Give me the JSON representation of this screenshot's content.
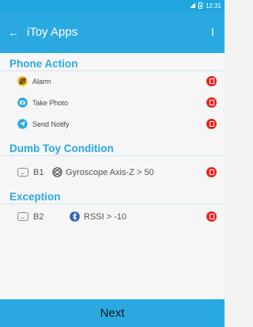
{
  "status_bar": {
    "time": "12:31"
  },
  "app_bar": {
    "back_glyph": "←",
    "title": "iToy Apps"
  },
  "sections": {
    "phone_action": {
      "title": "Phone Action",
      "items": [
        {
          "label": "Alarm",
          "icon": "alarm-icon",
          "color": "#f4b400"
        },
        {
          "label": "Take Photo",
          "icon": "camera-icon",
          "color": "#2aa9e0"
        },
        {
          "label": "Send Notify",
          "icon": "notify-icon",
          "color": "#2aa9e0"
        }
      ]
    },
    "dumb_toy_condition": {
      "title": "Dumb Toy Condition",
      "toy": "B1",
      "condition": "Gyroscope Axis-Z > 50",
      "condition_icon": "gyroscope-icon"
    },
    "exception": {
      "title": "Exception",
      "toy": "B2",
      "condition": "RSSI > -10",
      "condition_icon": "bluetooth-icon"
    }
  },
  "footer": {
    "next_label": "Next"
  },
  "colors": {
    "accent": "#2aa9e0",
    "delete": "#e8251f"
  }
}
